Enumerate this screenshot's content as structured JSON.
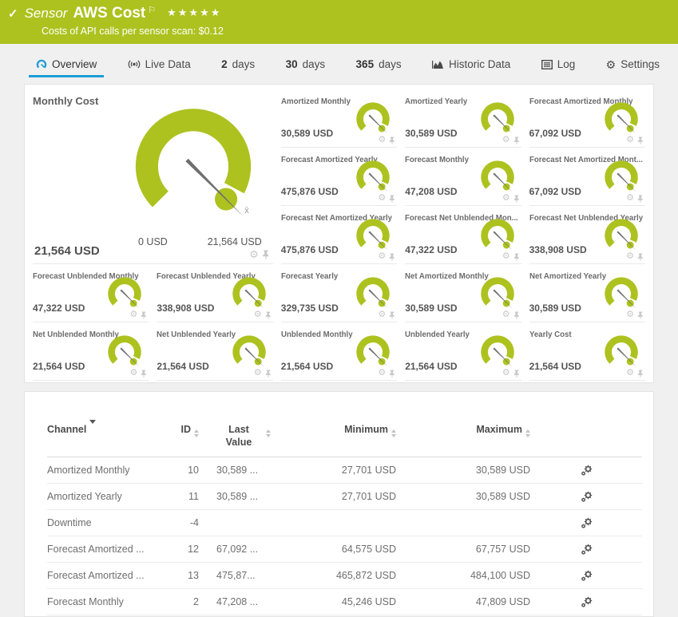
{
  "colors": {
    "brand_green": "#adc21f",
    "gauge_green": "#adc21f",
    "accent_blue": "#1e9cd7"
  },
  "header": {
    "check_icon": "✓",
    "kind_label": "Sensor",
    "title": "AWS Cost",
    "stars": "★★★★★",
    "subtitle": "Costs of API calls per sensor scan: $0.12"
  },
  "tabs": [
    {
      "id": "overview",
      "icon": "gauge-icon",
      "label": "Overview",
      "active": true
    },
    {
      "id": "live-data",
      "icon": "broadcast-icon",
      "label": "Live Data",
      "active": false
    },
    {
      "id": "2-days",
      "num": "2",
      "label": "days",
      "active": false
    },
    {
      "id": "30-days",
      "num": "30",
      "label": "days",
      "active": false
    },
    {
      "id": "365-days",
      "num": "365",
      "label": "days",
      "active": false
    },
    {
      "id": "historic-data",
      "icon": "historic-chart-icon",
      "label": "Historic Data",
      "active": false
    },
    {
      "id": "log",
      "icon": "log-icon",
      "label": "Log",
      "active": false
    },
    {
      "id": "settings",
      "icon": "settings-gear-icon",
      "label": "Settings",
      "active": false
    }
  ],
  "primary_gauge": {
    "label": "Monthly Cost",
    "value": "21,564 USD",
    "min_label": "0 USD",
    "max_label": "21,564 USD",
    "mean_icon": "x̄"
  },
  "small_gauges": [
    {
      "label": "Amortized Monthly",
      "value": "30,589 USD"
    },
    {
      "label": "Amortized Yearly",
      "value": "30,589 USD"
    },
    {
      "label": "Forecast Amortized Monthly",
      "value": "67,092 USD"
    },
    {
      "label": "Forecast Amortized Yearly",
      "value": "475,876 USD"
    },
    {
      "label": "Forecast Monthly",
      "value": "47,208 USD"
    },
    {
      "label": "Forecast Net Amortized Mont...",
      "value": "67,092 USD"
    },
    {
      "label": "Forecast Net Amortized Yearly",
      "value": "475,876 USD"
    },
    {
      "label": "Forecast Net Unblended Mon...",
      "value": "47,322 USD"
    },
    {
      "label": "Forecast Net Unblended Yearly",
      "value": "338,908 USD"
    },
    {
      "label": "Forecast Unblended Monthly",
      "value": "47,322 USD"
    },
    {
      "label": "Forecast Unblended Yearly",
      "value": "338,908 USD"
    },
    {
      "label": "Forecast Yearly",
      "value": "329,735 USD"
    },
    {
      "label": "Net Amortized Monthly",
      "value": "30,589 USD"
    },
    {
      "label": "Net Amortized Yearly",
      "value": "30,589 USD"
    },
    {
      "label": "Net Unblended Monthly",
      "value": "21,564 USD"
    },
    {
      "label": "Net Unblended Yearly",
      "value": "21,564 USD"
    },
    {
      "label": "Unblended Monthly",
      "value": "21,564 USD"
    },
    {
      "label": "Unblended Yearly",
      "value": "21,564 USD"
    },
    {
      "label": "Yearly Cost",
      "value": "21,564 USD"
    }
  ],
  "table": {
    "columns": [
      {
        "label": "Channel",
        "sort": "desc",
        "align": "left"
      },
      {
        "label": "ID",
        "sort": "both",
        "align": "right"
      },
      {
        "label": "Last Value",
        "sort": "both",
        "align": "center"
      },
      {
        "label": "Minimum",
        "sort": "both",
        "align": "right"
      },
      {
        "label": "Maximum",
        "sort": "both",
        "align": "right"
      },
      {
        "label": "",
        "sort": "none",
        "align": "center"
      }
    ],
    "rows": [
      {
        "channel": "Amortized Monthly",
        "id": "10",
        "last": "30,589 ...",
        "min": "27,701 USD",
        "max": "30,589 USD"
      },
      {
        "channel": "Amortized Yearly",
        "id": "11",
        "last": "30,589 ...",
        "min": "27,701 USD",
        "max": "30,589 USD"
      },
      {
        "channel": "Downtime",
        "id": "-4",
        "last": "",
        "min": "",
        "max": ""
      },
      {
        "channel": "Forecast Amortized ...",
        "id": "12",
        "last": "67,092 ...",
        "min": "64,575 USD",
        "max": "67,757 USD"
      },
      {
        "channel": "Forecast Amortized ...",
        "id": "13",
        "last": "475,87...",
        "min": "465,872 USD",
        "max": "484,100 USD"
      },
      {
        "channel": "Forecast Monthly",
        "id": "2",
        "last": "47,208 ...",
        "min": "45,246 USD",
        "max": "47,809 USD"
      }
    ]
  }
}
